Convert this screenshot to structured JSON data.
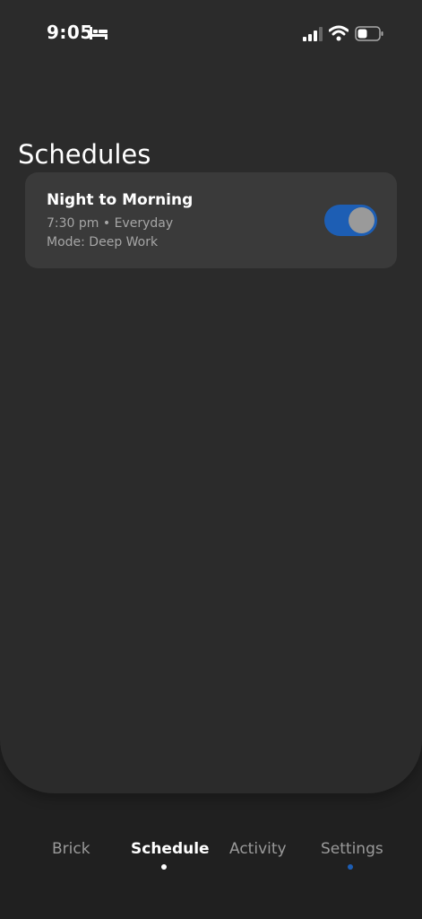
{
  "status_bar": {
    "time": "9:05",
    "icons": [
      "bed-icon",
      "signal-icon",
      "wifi-icon",
      "battery-icon"
    ]
  },
  "page": {
    "title": "Schedules"
  },
  "schedules": [
    {
      "name": "Night to Morning",
      "time": "7:30 pm • Everyday",
      "mode": "Mode: Deep Work",
      "enabled": true
    }
  ],
  "tabs": [
    {
      "label": "Brick",
      "active": false
    },
    {
      "label": "Schedule",
      "active": true
    },
    {
      "label": "Activity",
      "active": false
    },
    {
      "label": "Settings",
      "active": false,
      "badge": true
    }
  ],
  "colors": {
    "background": "#202020",
    "panel": "#2b2b2b",
    "card": "#3a3a3a",
    "accent": "#1d5eb4",
    "text_secondary": "#a6a6a6"
  }
}
